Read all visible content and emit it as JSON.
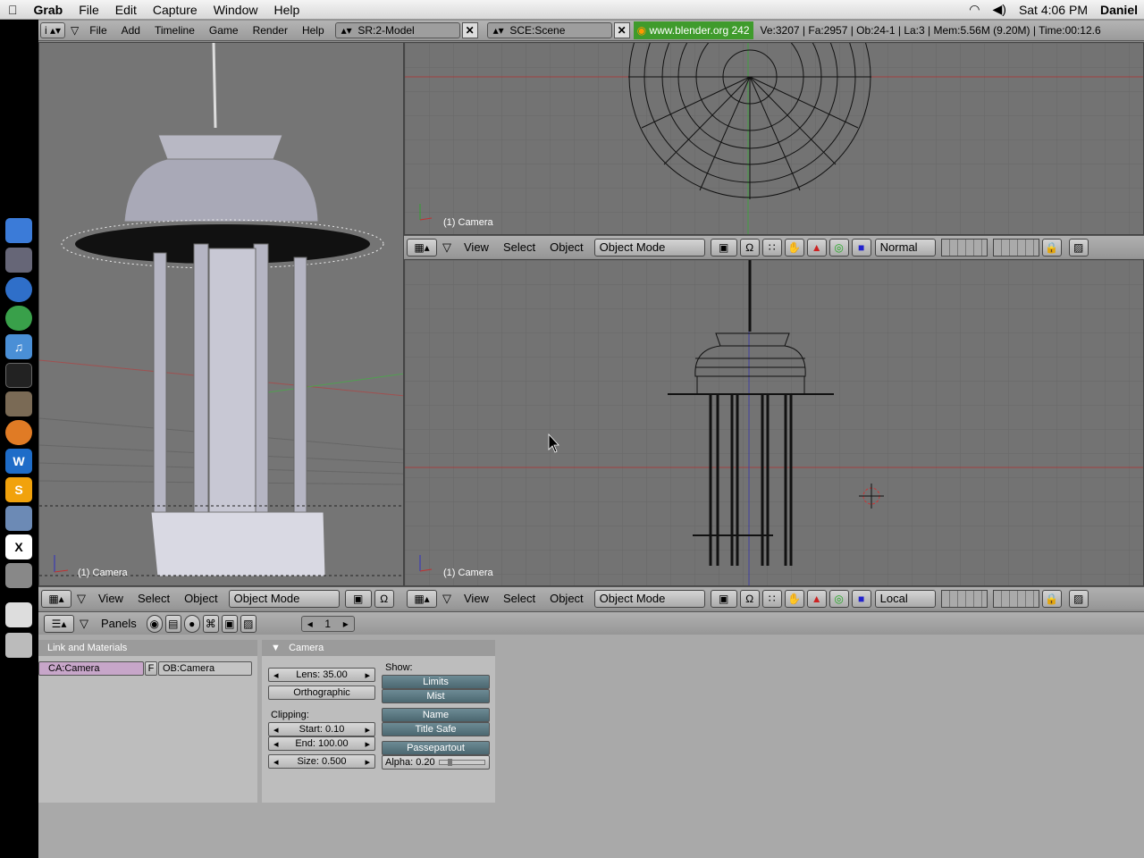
{
  "menubar": {
    "app": "Grab",
    "items": [
      "File",
      "Edit",
      "Capture",
      "Window",
      "Help"
    ],
    "clock": "Sat 4:06 PM",
    "user": "Daniel"
  },
  "info_header": {
    "menus": [
      "File",
      "Add",
      "Timeline",
      "Game",
      "Render",
      "Help"
    ],
    "screen": "SR:2-Model",
    "scene": "SCE:Scene",
    "link": "www.blender.org 242",
    "stats": "Ve:3207 | Fa:2957 | Ob:24-1 | La:3   | Mem:5.56M (9.20M)  | Time:00:12.6"
  },
  "viewports": {
    "left": {
      "label": "(1) Camera",
      "menus": [
        "View",
        "Select",
        "Object"
      ],
      "mode": "Object Mode"
    },
    "top_right": {
      "label": "(1) Camera",
      "menus": [
        "View",
        "Select",
        "Object"
      ],
      "mode": "Object Mode",
      "orientation": "Normal"
    },
    "bottom_right": {
      "label": "(1) Camera",
      "menus": [
        "View",
        "Select",
        "Object"
      ],
      "mode": "Object Mode",
      "orientation": "Local"
    }
  },
  "buttons_window": {
    "panels_label": "Panels",
    "frame": "1",
    "link_panel": {
      "title": "Link and Materials",
      "ca_field": "CA:Camera",
      "f_label": "F",
      "ob_field": "OB:Camera"
    },
    "camera_panel": {
      "title": "Camera",
      "lens": "Lens: 35.00",
      "orthographic": "Orthographic",
      "clipping_label": "Clipping:",
      "start": "Start: 0.10",
      "end": "End: 100.00",
      "size": "Size: 0.500",
      "show_label": "Show:",
      "limits": "Limits",
      "mist": "Mist",
      "name": "Name",
      "title_safe": "Title Safe",
      "passepartout": "Passepartout",
      "alpha": "Alpha: 0.20",
      "alpha_value": 0.2
    }
  }
}
